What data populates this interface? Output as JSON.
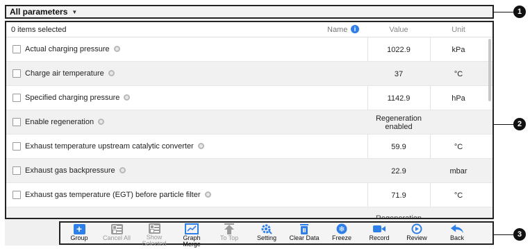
{
  "header": {
    "title": "All parameters"
  },
  "list": {
    "selected_text": "0 items selected",
    "columns": {
      "name": "Name",
      "value": "Value",
      "unit": "Unit"
    },
    "rows": [
      {
        "label": "Actual charging pressure",
        "value": "1022.9",
        "unit": "kPa"
      },
      {
        "label": "Charge air temperature",
        "value": "37",
        "unit": "°C"
      },
      {
        "label": "Specified charging pressure",
        "value": "1142.9",
        "unit": "hPa"
      },
      {
        "label": "Enable regeneration",
        "value": "Regeneration enabled",
        "unit": ""
      },
      {
        "label": "Exhaust temperature upstream catalytic converter",
        "value": "59.9",
        "unit": "°C"
      },
      {
        "label": "Exhaust gas backpressure",
        "value": "22.9",
        "unit": "mbar"
      },
      {
        "label": "Exhaust gas temperature (EGT) before particle filter",
        "value": "71.9",
        "unit": "°C"
      }
    ],
    "partial_row_value": "Regeneration"
  },
  "toolbar": {
    "group": "Group",
    "cancel_all": "Cancel All",
    "show_selected": "Show Selected",
    "graph_merge": "Graph Merge",
    "to_top": "To Top",
    "setting": "Setting",
    "clear_data": "Clear Data",
    "freeze": "Freeze",
    "record": "Record",
    "review": "Review",
    "back": "Back"
  },
  "callouts": {
    "one": "1",
    "two": "2",
    "three": "3"
  },
  "colors": {
    "accent": "#2f7fe8",
    "border": "#222222",
    "disabled": "#9a9a9a"
  }
}
